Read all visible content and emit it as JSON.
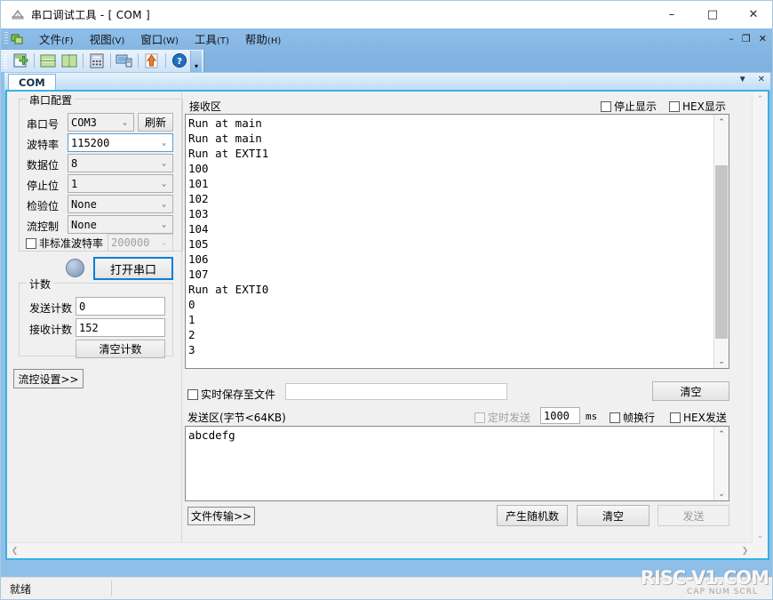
{
  "window": {
    "title": "串口调试工具 - [ COM ]",
    "icon": "serial-port-icon",
    "minimize": "–",
    "maximize": "□",
    "close": "✕"
  },
  "mdi_buttons": {
    "minimize": "–",
    "restore": "❐",
    "close": "✕"
  },
  "menubar": {
    "items": [
      {
        "label": "文件",
        "mnemonic": "(F)"
      },
      {
        "label": "视图",
        "mnemonic": "(V)"
      },
      {
        "label": "窗口",
        "mnemonic": "(W)"
      },
      {
        "label": "工具",
        "mnemonic": "(T)"
      },
      {
        "label": "帮助",
        "mnemonic": "(H)"
      }
    ]
  },
  "toolbar": {
    "buttons": [
      {
        "name": "new-session-icon"
      },
      {
        "name": "tile-horizontal-icon"
      },
      {
        "name": "tile-vertical-icon"
      },
      {
        "name": "calculator-icon"
      },
      {
        "name": "computer-icon"
      },
      {
        "name": "upload-icon"
      },
      {
        "name": "help-icon"
      }
    ],
    "overflow": "▾"
  },
  "tabstrip": {
    "tabs": [
      {
        "label": "COM"
      }
    ],
    "dropdown": "▼",
    "close": "✕"
  },
  "serial_config": {
    "title": "串口配置",
    "port": {
      "label": "串口号",
      "value": "COM3"
    },
    "refresh_button": "刷新",
    "baud": {
      "label": "波特率",
      "value": "115200"
    },
    "data_bits": {
      "label": "数据位",
      "value": "8"
    },
    "stop_bits": {
      "label": "停止位",
      "value": "1"
    },
    "parity": {
      "label": "检验位",
      "value": "None"
    },
    "flow_control": {
      "label": "流控制",
      "value": "None"
    },
    "custom_baud": {
      "label": "非标准波特率",
      "value": "200000",
      "checked": false
    }
  },
  "open_port_button": "打开串口",
  "led": {
    "name": "connection-status-led",
    "state": "off"
  },
  "counters": {
    "title": "计数",
    "tx": {
      "label": "发送计数",
      "value": "0"
    },
    "rx": {
      "label": "接收计数",
      "value": "152"
    },
    "clear_button": "清空计数"
  },
  "flow_settings_button": "流控设置>>",
  "receive": {
    "title": "接收区",
    "stop_display": {
      "label": "停止显示",
      "checked": false
    },
    "hex_display": {
      "label": "HEX显示",
      "checked": false
    },
    "content": "Run at main\nRun at main\nRun at EXTI1\n100\n101\n102\n103\n104\n105\n106\n107\nRun at EXTI0\n0\n1\n2\n3",
    "save_to_file": {
      "label": "实时保存至文件",
      "checked": false,
      "path": ""
    },
    "clear_button": "清空"
  },
  "send": {
    "title": "发送区(字节<64KB)",
    "timed_send": {
      "label": "定时发送",
      "checked": false,
      "disabled": true
    },
    "interval": {
      "value": "1000",
      "unit": "ms"
    },
    "frame_newline": {
      "label": "帧换行",
      "checked": false
    },
    "hex_send": {
      "label": "HEX发送",
      "checked": false
    },
    "content": "abcdefg",
    "file_transfer_button": "文件传输>>",
    "random_button": "产生随机数",
    "clear_button": "清空",
    "send_button": "发送",
    "send_disabled": true
  },
  "statusbar": {
    "text": "就绪"
  },
  "watermark": {
    "primary": "RISC-V1.COM",
    "secondary": "CAP NUM SCRL"
  },
  "colors": {
    "mdi_background": "#8ebfe9",
    "accent_border": "#3aafe8",
    "primary_button_border": "#0a7fd6",
    "panel": "#f0f0f0"
  }
}
